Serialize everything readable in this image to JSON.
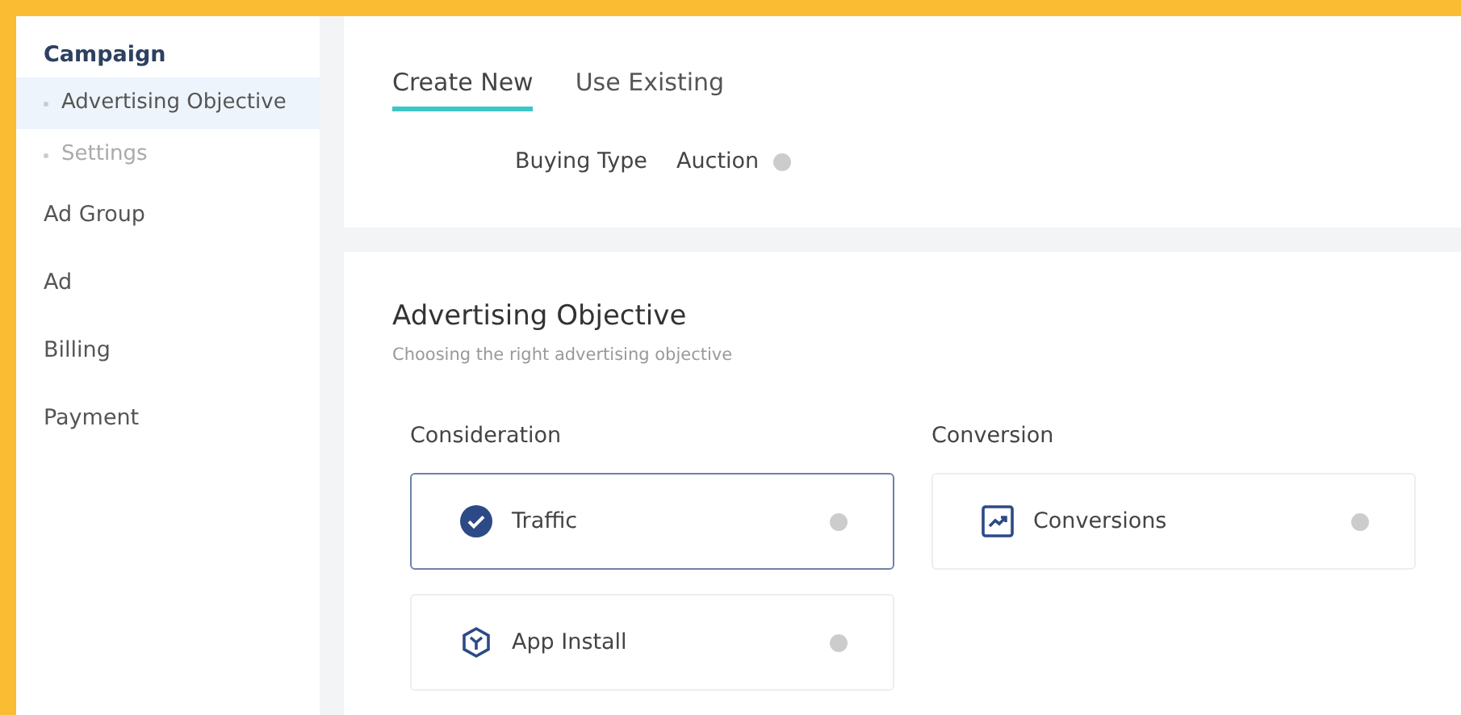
{
  "sidebar": {
    "items": [
      {
        "label": "Campaign",
        "selected": false,
        "children": [
          {
            "label": "Advertising Objective",
            "selected": true
          },
          {
            "label": "Settings",
            "selected": false
          }
        ]
      },
      {
        "label": "Ad Group",
        "selected": false
      },
      {
        "label": "Ad",
        "selected": false
      },
      {
        "label": "Billing",
        "selected": false
      },
      {
        "label": "Payment",
        "selected": false
      }
    ]
  },
  "tabs": [
    {
      "label": "Create New",
      "selected": true
    },
    {
      "label": "Use Existing",
      "selected": false
    }
  ],
  "buying_type": {
    "label": "Buying Type",
    "value": "Auction"
  },
  "objective": {
    "title": "Advertising Objective",
    "subtitle": "Choosing the right advertising objective",
    "groups": [
      {
        "title": "Consideration",
        "options": [
          {
            "label": "Traffic",
            "selected": true
          },
          {
            "label": "App Install",
            "selected": false
          }
        ]
      },
      {
        "title": "Conversion",
        "options": [
          {
            "label": "Conversions",
            "selected": false
          }
        ]
      }
    ]
  }
}
